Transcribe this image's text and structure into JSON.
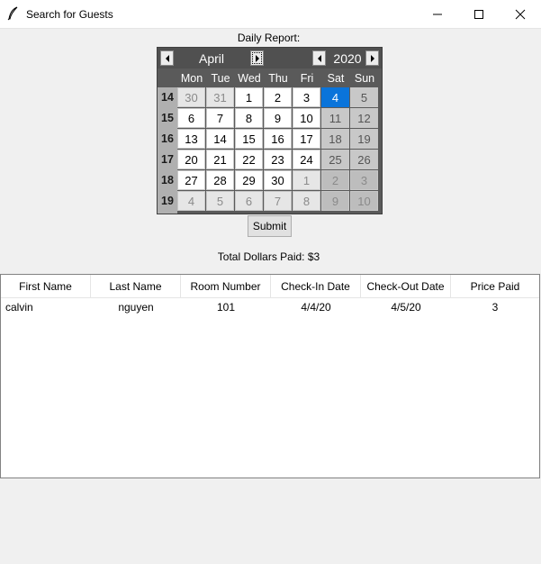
{
  "window": {
    "title": "Search for Guests",
    "icon": "feather-icon"
  },
  "report": {
    "label": "Daily Report:",
    "submit_label": "Submit",
    "total_label": "Total Dollars Paid: $3"
  },
  "calendar": {
    "month": "April",
    "year": "2020",
    "days_of_week": [
      "Mon",
      "Tue",
      "Wed",
      "Thu",
      "Fri",
      "Sat",
      "Sun"
    ],
    "selected_day": "4",
    "accent_color": "#0a74da",
    "weeks": [
      {
        "week": "14",
        "days": [
          "30",
          "31",
          "1",
          "2",
          "3",
          "4",
          "5"
        ],
        "in_month": [
          false,
          false,
          true,
          true,
          true,
          true,
          true
        ]
      },
      {
        "week": "15",
        "days": [
          "6",
          "7",
          "8",
          "9",
          "10",
          "11",
          "12"
        ],
        "in_month": [
          true,
          true,
          true,
          true,
          true,
          true,
          true
        ]
      },
      {
        "week": "16",
        "days": [
          "13",
          "14",
          "15",
          "16",
          "17",
          "18",
          "19"
        ],
        "in_month": [
          true,
          true,
          true,
          true,
          true,
          true,
          true
        ]
      },
      {
        "week": "17",
        "days": [
          "20",
          "21",
          "22",
          "23",
          "24",
          "25",
          "26"
        ],
        "in_month": [
          true,
          true,
          true,
          true,
          true,
          true,
          true
        ]
      },
      {
        "week": "18",
        "days": [
          "27",
          "28",
          "29",
          "30",
          "1",
          "2",
          "3"
        ],
        "in_month": [
          true,
          true,
          true,
          true,
          false,
          false,
          false
        ]
      },
      {
        "week": "19",
        "days": [
          "4",
          "5",
          "6",
          "7",
          "8",
          "9",
          "10"
        ],
        "in_month": [
          false,
          false,
          false,
          false,
          false,
          false,
          false
        ]
      }
    ]
  },
  "table": {
    "columns": [
      "First Name",
      "Last Name",
      "Room Number",
      "Check-In Date",
      "Check-Out Date",
      "Price Paid"
    ],
    "rows": [
      [
        "calvin",
        "nguyen",
        "101",
        "4/4/20",
        "4/5/20",
        "3"
      ]
    ]
  }
}
